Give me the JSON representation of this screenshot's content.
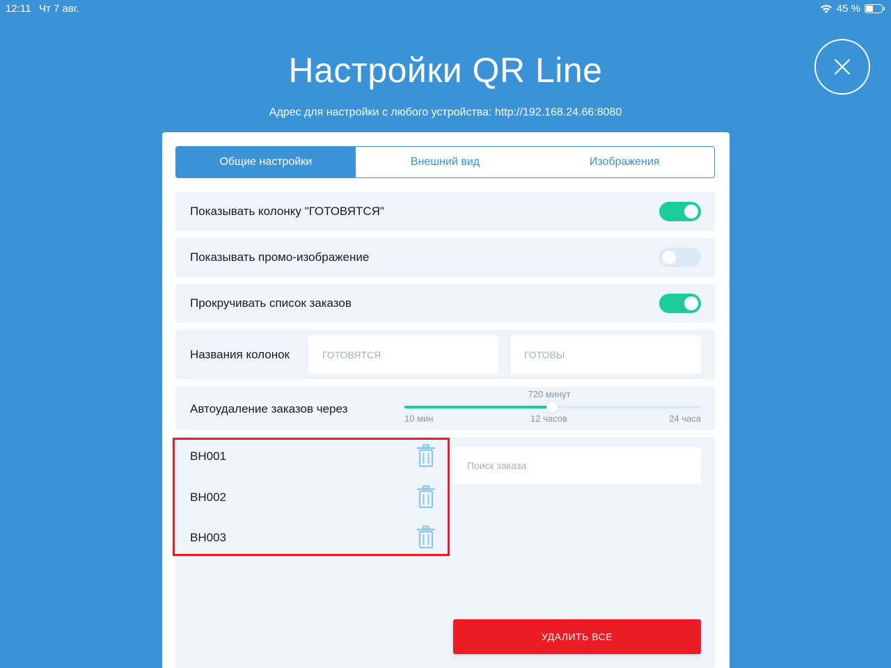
{
  "status_bar": {
    "time": "12:11",
    "date": "Чт 7 авг.",
    "battery": "45 %",
    "battery_level": 0.45
  },
  "header": {
    "title": "Настройки QR Line",
    "subtitle": "Адрес для настройки с любого устройства: http://192.168.24.66:8080"
  },
  "tabs": [
    {
      "label": "Общие настройки",
      "active": true
    },
    {
      "label": "Внешний вид",
      "active": false
    },
    {
      "label": "Изображения",
      "active": false
    }
  ],
  "settings": {
    "show_preparing": {
      "label": "Показывать колонку \"ГОТОВЯТСЯ\"",
      "on": true
    },
    "show_promo": {
      "label": "Показывать промо-изображение",
      "on": false
    },
    "scroll_orders": {
      "label": "Прокручивать список заказов",
      "on": true
    },
    "column_names": {
      "label": "Названия колонок",
      "preparing_placeholder": "ГОТОВЯТСЯ",
      "ready_placeholder": "ГОТОВЫ"
    },
    "auto_delete": {
      "label": "Автоудаление заказов через",
      "value_label": "720 минут",
      "value_minutes": 720,
      "min_minutes": 10,
      "max_minutes": 1440,
      "tick_min": "10 мин",
      "tick_mid": "12 часов",
      "tick_max": "24 часа"
    }
  },
  "orders": {
    "items": [
      "BH001",
      "BH002",
      "BH003"
    ],
    "search_placeholder": "Поиск заказа",
    "delete_all_label": "УДАЛИТЬ ВСЕ"
  },
  "colors": {
    "background": "#3a93d6",
    "toggle_on": "#1ccd9c",
    "danger": "#ec1c24",
    "highlight": "#ec1c24"
  }
}
